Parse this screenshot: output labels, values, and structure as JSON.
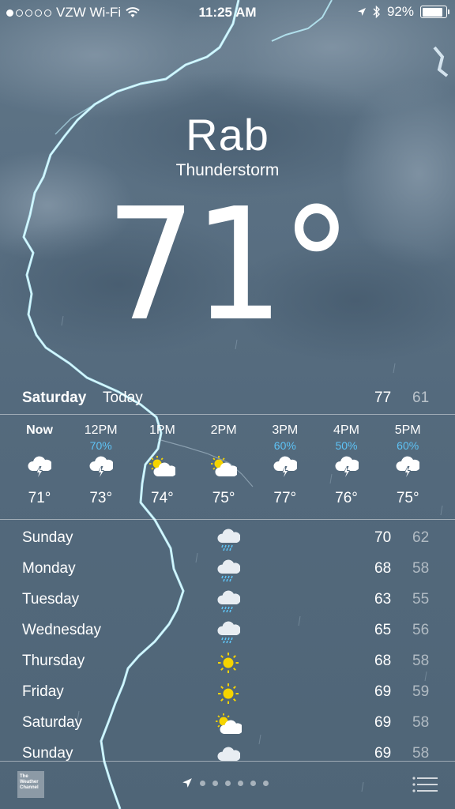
{
  "status_bar": {
    "carrier": "VZW Wi-Fi",
    "time": "11:25 AM",
    "battery": "92%",
    "battery_level": 0.92
  },
  "header": {
    "city": "Rab",
    "condition": "Thunderstorm",
    "temperature": "71°"
  },
  "today": {
    "day": "Saturday",
    "label": "Today",
    "high": "77",
    "low": "61"
  },
  "hourly": [
    {
      "time": "Now",
      "precip": "",
      "icon": "thunderstorm-icon",
      "temp": "71°"
    },
    {
      "time": "12PM",
      "precip": "70%",
      "icon": "thunderstorm-icon",
      "temp": "73°"
    },
    {
      "time": "1PM",
      "precip": "",
      "icon": "partly-cloudy-icon",
      "temp": "74°"
    },
    {
      "time": "2PM",
      "precip": "",
      "icon": "partly-cloudy-icon",
      "temp": "75°"
    },
    {
      "time": "3PM",
      "precip": "60%",
      "icon": "thunderstorm-icon",
      "temp": "77°"
    },
    {
      "time": "4PM",
      "precip": "50%",
      "icon": "thunderstorm-icon",
      "temp": "76°"
    },
    {
      "time": "5PM",
      "precip": "60%",
      "icon": "thunderstorm-icon",
      "temp": "75°"
    }
  ],
  "daily": [
    {
      "day": "Sunday",
      "icon": "rain-icon",
      "high": "70",
      "low": "62"
    },
    {
      "day": "Monday",
      "icon": "rain-icon",
      "high": "68",
      "low": "58"
    },
    {
      "day": "Tuesday",
      "icon": "rain-icon",
      "high": "63",
      "low": "55"
    },
    {
      "day": "Wednesday",
      "icon": "rain-icon",
      "high": "65",
      "low": "56"
    },
    {
      "day": "Thursday",
      "icon": "sun-icon",
      "high": "68",
      "low": "58"
    },
    {
      "day": "Friday",
      "icon": "sun-icon",
      "high": "69",
      "low": "59"
    },
    {
      "day": "Saturday",
      "icon": "partly-cloudy-icon",
      "high": "69",
      "low": "58"
    },
    {
      "day": "Sunday",
      "icon": "cloud-icon",
      "high": "69",
      "low": "58"
    }
  ],
  "bottom_bar": {
    "logo_text": "The Weather Channel",
    "page_count": 6
  },
  "colors": {
    "precip": "#5ec3f5",
    "sun": "#f5d400",
    "lightning": "#bff4ff"
  }
}
